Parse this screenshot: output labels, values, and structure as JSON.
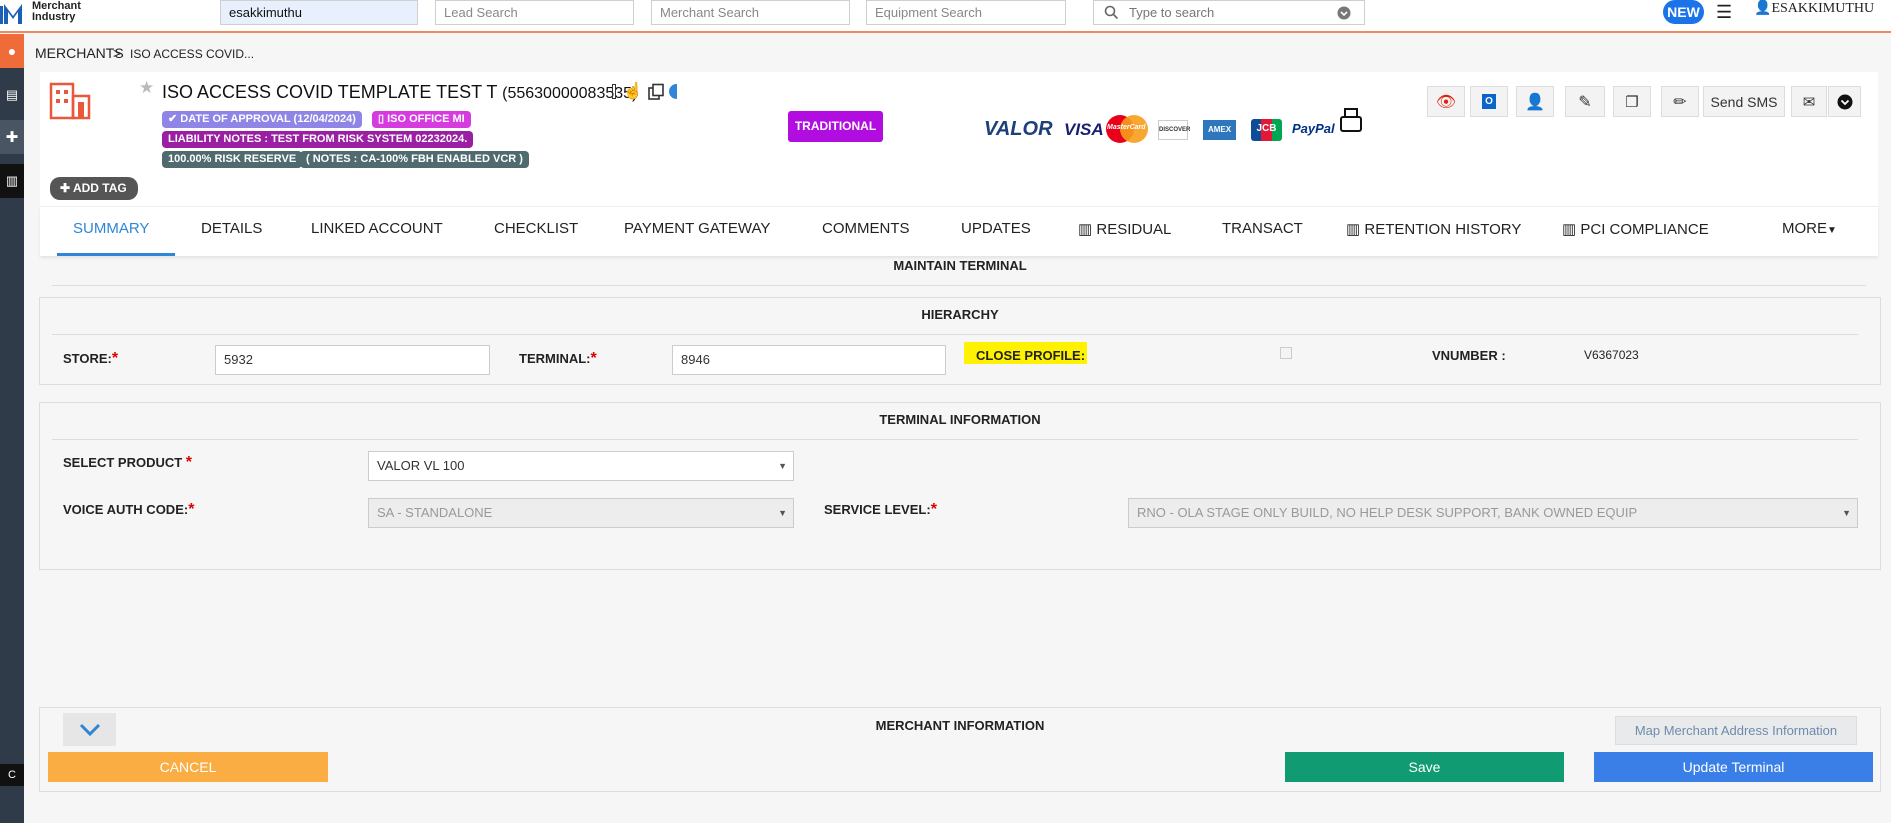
{
  "topbar": {
    "logo_line1": "Merchant",
    "logo_line2": "Industry",
    "search_user_value": "esakkimuthu",
    "lead_search_placeholder": "Lead Search",
    "merchant_search_placeholder": "Merchant Search",
    "equipment_search_placeholder": "Equipment Search",
    "global_search_placeholder": "Type to search",
    "new_badge": "NEW",
    "username": "ESAKKIMUTHU"
  },
  "rail": {
    "bottom_label": "C"
  },
  "breadcrumb": {
    "root": "MERCHANTS",
    "separator": ">",
    "current": "ISO ACCESS COVID..."
  },
  "merchant": {
    "name": "ISO ACCESS COVID TEMPLATE TEST T",
    "id": "(55630000083535)",
    "badges": {
      "approval": "DATE OF APPROVAL (12/04/2024)",
      "office": "ISO OFFICE MI",
      "liability": "LIABILITY NOTES : TEST FROM RISK SYSTEM 02232024.",
      "reserve": "100.00% RISK RESERVE",
      "notes": "( NOTES : CA-100% FBH ENABLED VCR )"
    },
    "add_tag": "ADD TAG",
    "type_badge": "TRADITIONAL",
    "payment_brands": {
      "valor": "VALOR",
      "visa": "VISA",
      "mastercard": "MasterCard",
      "discover": "DISCOVER",
      "amex": "AMEX",
      "jcb": "JCB",
      "paypal": "PayPal"
    },
    "send_sms": "Send SMS"
  },
  "tabs": [
    "SUMMARY",
    "DETAILS",
    "LINKED ACCOUNT",
    "CHECKLIST",
    "PAYMENT GATEWAY",
    "COMMENTS",
    "UPDATES",
    "RESIDUAL",
    "TRANSACT",
    "RETENTION HISTORY",
    "PCI COMPLIANCE",
    "MORE"
  ],
  "maintain_terminal": {
    "title": "MAINTAIN TERMINAL",
    "hierarchy": {
      "title": "HIERARCHY",
      "store_label": "STORE:",
      "store_value": "5932",
      "terminal_label": "TERMINAL:",
      "terminal_value": "8946",
      "close_profile_label": "CLOSE PROFILE:",
      "vnumber_label": "VNUMBER :",
      "vnumber_value": "V6367023"
    },
    "terminal_info": {
      "title": "TERMINAL INFORMATION",
      "select_product_label": "SELECT PRODUCT",
      "select_product_value": "VALOR VL 100",
      "voice_auth_label": "VOICE AUTH CODE:",
      "voice_auth_value": "SA - STANDALONE",
      "service_level_label": "SERVICE LEVEL:",
      "service_level_value": "RNO - OLA STAGE ONLY BUILD, NO HELP DESK SUPPORT, BANK OWNED EQUIP"
    },
    "merchant_info": {
      "title": "MERCHANT INFORMATION",
      "map_button": "Map Merchant Address Information"
    },
    "cancel": "CANCEL",
    "save": "Save",
    "update": "Update Terminal"
  },
  "colors": {
    "accent": "#2f86d6",
    "cancel": "#f9ad42",
    "save": "#109b72",
    "update": "#3a7fe8",
    "traditional": "#b10de0"
  }
}
